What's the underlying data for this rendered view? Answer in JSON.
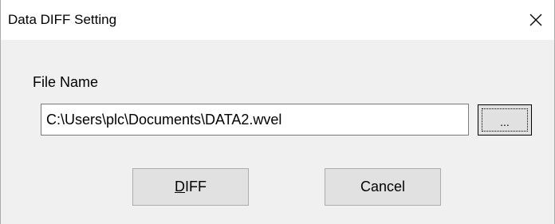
{
  "window": {
    "title": "Data DIFF Setting",
    "close_icon": "close-icon"
  },
  "form": {
    "file_name_label": "File Name",
    "file_path_value": "C:\\Users\\plc\\Documents\\DATA2.wvel",
    "browse_label": "...",
    "browse_icon": "ellipsis-icon"
  },
  "actions": {
    "diff_label": "DIFF",
    "cancel_label": "Cancel"
  },
  "colors": {
    "titlebar_bg": "#ffffff",
    "dialog_bg": "#f0f0f0",
    "button_bg": "#e1e1e1",
    "button_border": "#adadad",
    "input_border": "#7a7a7a"
  }
}
